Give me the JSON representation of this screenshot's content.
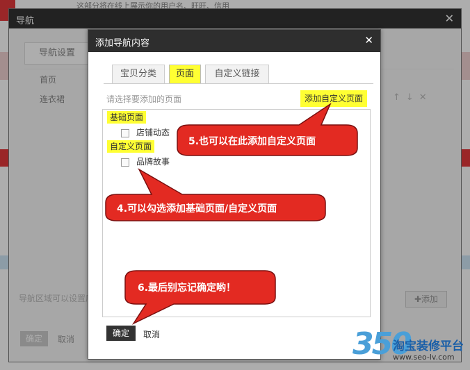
{
  "background": {
    "top_text": "这部分将在线上展示你的用户名、旺旺、信用"
  },
  "outer_dialog": {
    "title": "导航",
    "close_icon": "close-icon",
    "tab_label": "导航设置",
    "list_items": [
      "首页",
      "连衣裙"
    ],
    "hint": "导航区域可以设置店铺",
    "add_button": "添加",
    "confirm_button": "确定",
    "cancel_button": "取消"
  },
  "inner_dialog": {
    "title": "添加导航内容",
    "tabs": [
      {
        "label": "宝贝分类",
        "active": false
      },
      {
        "label": "页面",
        "active": true
      },
      {
        "label": "自定义链接",
        "active": false
      }
    ],
    "section_label": "请选择要添加的页面",
    "add_custom_link": "添加自定义页面",
    "groups": [
      {
        "label": "基础页面",
        "items": [
          {
            "label": "店铺动态",
            "checked": false
          }
        ]
      },
      {
        "label": "自定义页面",
        "items": [
          {
            "label": "品牌故事",
            "checked": false
          }
        ]
      }
    ],
    "ok_button": "确定",
    "cancel_button": "取消"
  },
  "callouts": [
    {
      "text": "5.也可以在此添加自定义页面"
    },
    {
      "text": "4.可以勾选添加基础页面/自定义页面"
    },
    {
      "text": "6.最后别忘记确定哟！"
    }
  ],
  "watermark": {
    "number": "350",
    "name": "淘宝装修平台",
    "url": "www.seo-lv.com"
  },
  "colors": {
    "highlight": "#ffff33",
    "callout_fill": "#e32a22",
    "titlebar": "#2e2e2e"
  }
}
